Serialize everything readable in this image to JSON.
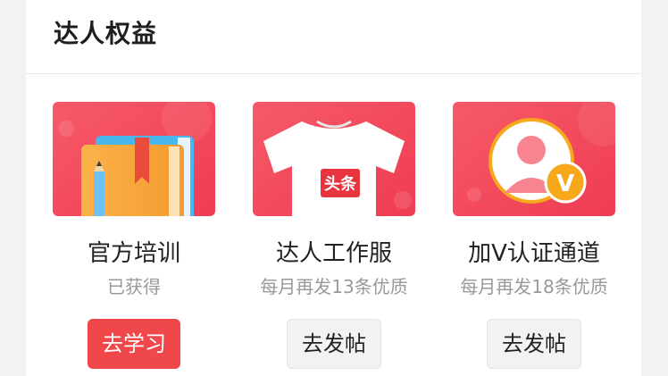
{
  "section": {
    "title": "达人权益"
  },
  "benefits": [
    {
      "title": "官方培训",
      "subtitle": "已获得",
      "button": "去学习",
      "icon": "book-icon"
    },
    {
      "title": "达人工作服",
      "subtitle": "每月再发13条优质",
      "button": "去发帖",
      "icon": "tshirt-icon",
      "logo_text": "头条"
    },
    {
      "title": "加V认证通道",
      "subtitle": "每月再发18条优质",
      "button": "去发帖",
      "icon": "verified-user-icon",
      "badge_text": "V"
    }
  ],
  "colors": {
    "accent": "#f0474b",
    "thumb_bg": "#f34d5d",
    "badge": "#f7a81b"
  }
}
